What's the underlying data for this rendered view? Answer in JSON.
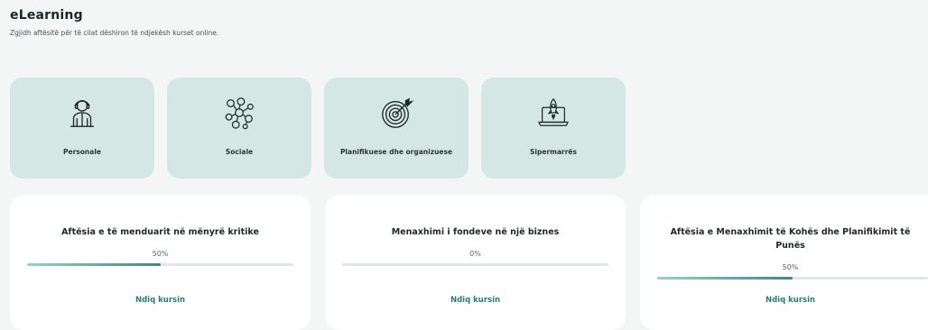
{
  "header": {
    "title": "eLearning",
    "subtitle": "Zgjidh aftësitë për të cilat dëshiron të ndjekësh kurset online."
  },
  "categories": [
    {
      "label": "Personale",
      "icon": "person-icon"
    },
    {
      "label": "Sociale",
      "icon": "social-network-icon"
    },
    {
      "label": "Planifikuese dhe organizuese",
      "icon": "target-icon"
    },
    {
      "label": "Sipermarrës",
      "icon": "laptop-rocket-icon"
    }
  ],
  "courses": [
    {
      "title": "Aftësia e të menduarit në mënyrë kritike",
      "progress_text": "50%",
      "progress": 0.5,
      "link": "Ndiq kursin"
    },
    {
      "title": "Menaxhimi i fondeve në një biznes",
      "progress_text": "0%",
      "progress": 0.0,
      "link": "Ndiq kursin"
    },
    {
      "title": "Aftësia e Menaxhimit të Kohës dhe Planifikimit të Punës",
      "progress_text": "50%",
      "progress": 0.5,
      "link": "Ndiq kursin"
    }
  ],
  "colors": {
    "category_bg": "#d4e7e5",
    "accent": "#2b7a78",
    "page_bg": "#f4f5f5"
  }
}
